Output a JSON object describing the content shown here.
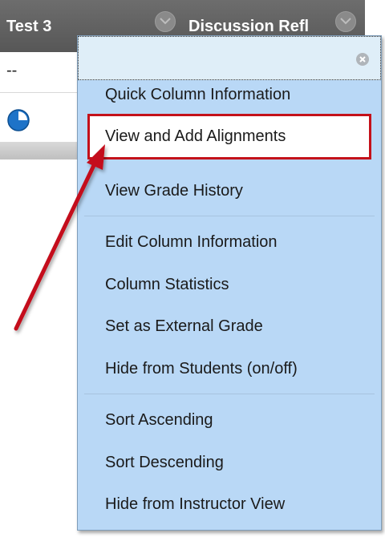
{
  "grid": {
    "columns": [
      {
        "title": "Test 3"
      },
      {
        "title": "Discussion Refl"
      }
    ],
    "row1_value": "--"
  },
  "menu": {
    "items": [
      {
        "label": "Quick Column Information"
      },
      {
        "label": "View and Add Alignments",
        "highlighted": true
      },
      {
        "label": "View Grade History"
      },
      {
        "label": "Edit Column Information"
      },
      {
        "label": "Column Statistics"
      },
      {
        "label": "Set as External Grade"
      },
      {
        "label": "Hide from Students (on/off)"
      },
      {
        "label": "Sort Ascending"
      },
      {
        "label": "Sort Descending"
      },
      {
        "label": "Hide from Instructor View"
      }
    ]
  },
  "colors": {
    "menu_bg": "#b9d8f6",
    "highlight_border": "#c4111a",
    "arrow": "#c4111a",
    "header_bg": "#575757"
  },
  "icons": {
    "close": "close-icon",
    "status": "in-progress-clock-icon",
    "column_menu": "chevron-down-icon"
  }
}
